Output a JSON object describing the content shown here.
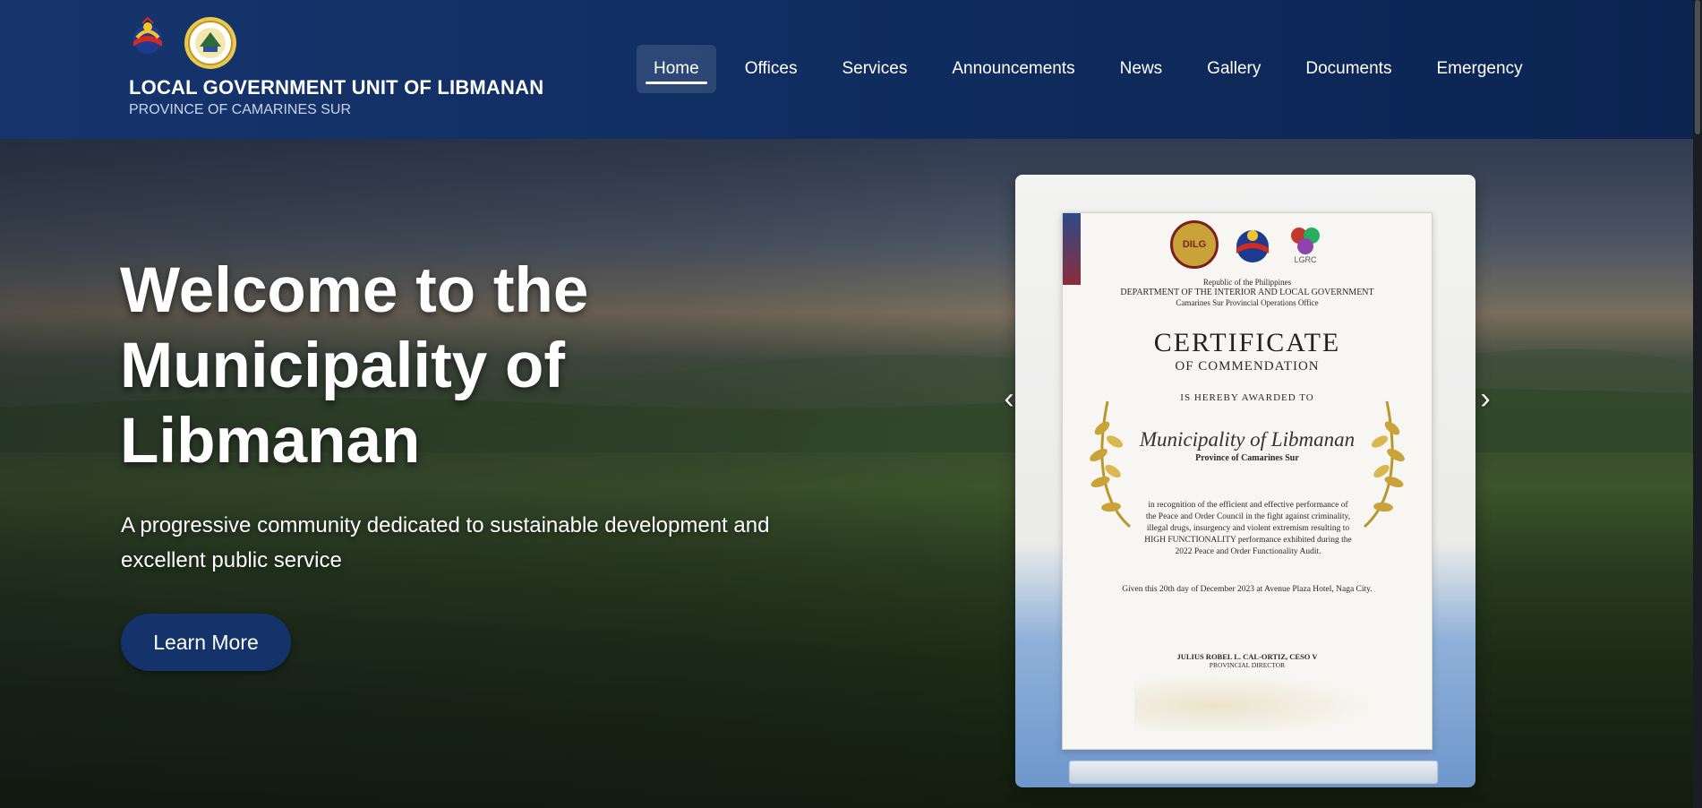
{
  "header": {
    "brand_title": "LOCAL GOVERNMENT UNIT OF LIBMANAN",
    "brand_subtitle": "PROVINCE OF CAMARINES SUR",
    "logos": [
      "bagong-pilipinas-logo",
      "libmanan-seal"
    ],
    "nav": [
      {
        "label": "Home",
        "active": true
      },
      {
        "label": "Offices",
        "active": false
      },
      {
        "label": "Services",
        "active": false
      },
      {
        "label": "Announcements",
        "active": false
      },
      {
        "label": "News",
        "active": false
      },
      {
        "label": "Gallery",
        "active": false
      },
      {
        "label": "Documents",
        "active": false
      },
      {
        "label": "Emergency",
        "active": false
      }
    ]
  },
  "hero": {
    "title": "Welcome to the Municipality of Libmanan",
    "tagline": "A progressive community dedicated to sustainable development and excellent public service",
    "cta_label": "Learn More",
    "prev_icon": "‹",
    "next_icon": "›"
  },
  "certificate": {
    "seal_text": "DILG",
    "lgrc_text": "LGRC",
    "republic": "Republic of the Philippines",
    "department": "DEPARTMENT OF THE INTERIOR AND LOCAL GOVERNMENT",
    "office": "Camarines Sur Provincial Operations Office",
    "title": "CERTIFICATE",
    "subtitle": "OF COMMENDATION",
    "awarded": "IS HEREBY AWARDED TO",
    "recipient": "Municipality of Libmanan",
    "province": "Province of Camarines Sur",
    "body": "in recognition of the efficient and effective performance of the Peace and Order Council in the fight against criminality, illegal drugs, insurgency and violent extremism resulting to HIGH FUNCTIONALITY performance exhibited during the 2022 Peace and Order Functionality Audit.",
    "given": "Given this 20th day of December 2023 at Avenue Plaza Hotel, Naga City.",
    "signatory": "JULIUS ROBEL L. CAL-ORTIZ, CESO V",
    "signatory_role": "PROVINCIAL DIRECTOR"
  },
  "colors": {
    "header_bg": "#16356e",
    "cta_bg": "#14336b",
    "text_primary": "#ffffff"
  }
}
